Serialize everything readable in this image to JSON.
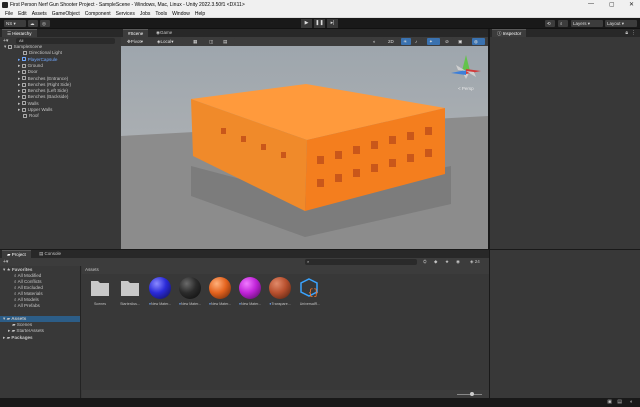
{
  "window": {
    "title": "First Person Nerf Gun Shooter Project - SampleScene - Windows, Mac, Linux - Unity 2022.3.50f1 <DX11>",
    "controls": [
      "—",
      "▢",
      "✕"
    ]
  },
  "menu": [
    "File",
    "Edit",
    "Assets",
    "GameObject",
    "Component",
    "Services",
    "Jobs",
    "Tools",
    "Window",
    "Help"
  ],
  "toolbar": {
    "account": "NS",
    "layers_label": "Layers",
    "layout_label": "Layout"
  },
  "hierarchy": {
    "tab": "Hierarchy",
    "search_placeholder": "All",
    "scene": "SampleScene",
    "items": [
      "Directional Light",
      "PlayerCapsule",
      "Ground",
      "Door",
      "Benches (Entrance)",
      "Benches (Right Side)",
      "Benches (Left Side)",
      "Benches (Backside)",
      "Walls",
      "Upper Walls",
      "Roof"
    ]
  },
  "scene_view": {
    "tabs": [
      "Scene",
      "Game"
    ],
    "pivot_label": "Pivot",
    "space_label": "Local",
    "gizmo_label": "< Persp",
    "building_color": "#ff9a3c",
    "building_dark": "#f07a1a",
    "ground_color": "#8a8a8a"
  },
  "inspector": {
    "tab": "Inspector"
  },
  "project": {
    "tabs": [
      "Project",
      "Console"
    ],
    "favorites_label": "Favorites",
    "favorites": [
      "All Modified",
      "All Conflicts",
      "All Excluded",
      "All Materials",
      "All Models",
      "All Prefabs"
    ],
    "assets_label": "Assets",
    "asset_folders": [
      "Scenes",
      "StarterAssets"
    ],
    "packages_label": "Packages",
    "breadcrumb": "Assets",
    "count": "24",
    "items": [
      {
        "name": "Scenes",
        "kind": "folder",
        "color": "#c8c8c8"
      },
      {
        "name": "StarterAss...",
        "kind": "folder",
        "color": "#c8c8c8"
      },
      {
        "name": "New Mater...",
        "kind": "material",
        "color": "#2a2ad8"
      },
      {
        "name": "New Mater...",
        "kind": "material",
        "color": "#2b2b2b"
      },
      {
        "name": "New Mater...",
        "kind": "material",
        "color": "#e4631e"
      },
      {
        "name": "New Mater...",
        "kind": "material",
        "color": "#c023d8"
      },
      {
        "name": "Transpare...",
        "kind": "material",
        "color": "#b8502e"
      },
      {
        "name": "UniversalR...",
        "kind": "package",
        "color": "#3aa4ff"
      }
    ]
  }
}
